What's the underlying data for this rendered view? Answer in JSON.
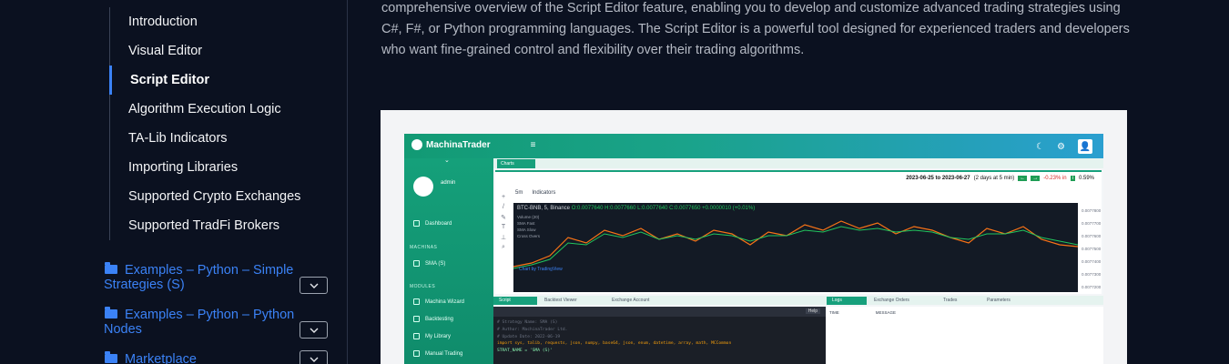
{
  "sidebar": {
    "subnav_items": [
      {
        "label": "Introduction",
        "active": false
      },
      {
        "label": "Visual Editor",
        "active": false
      },
      {
        "label": "Script Editor",
        "active": true
      },
      {
        "label": "Algorithm Execution Logic",
        "active": false
      },
      {
        "label": "TA-Lib Indicators",
        "active": false
      },
      {
        "label": "Importing Libraries",
        "active": false
      },
      {
        "label": "Supported Crypto Exchanges",
        "active": false
      },
      {
        "label": "Supported TradFi Brokers",
        "active": false
      }
    ],
    "sections": [
      {
        "label": "Examples – Python – Simple Strategies (S)"
      },
      {
        "label": "Examples – Python – Python Nodes"
      },
      {
        "label": "Marketplace"
      }
    ],
    "icons": {
      "section": "folder-icon",
      "toggle": "chevron-down-icon"
    }
  },
  "main": {
    "description": "comprehensive overview of the Script Editor feature, enabling you to develop and customize advanced trading strategies using C#, F#, or Python programming languages. The Script Editor is a powerful tool designed for experienced traders and developers who want fine-grained control and flexibility over their trading algorithms."
  },
  "screenshot": {
    "brand": "MachinaTrader",
    "user": "admin",
    "tab": "Charts",
    "nav_headers": [
      "MACHINAS",
      "MODULES"
    ],
    "nav_items": [
      "Dashboard",
      "SMA (S)",
      "Machina Wizard",
      "Backtesting",
      "My Library",
      "Manual Trading"
    ],
    "date_range": "2023-06-25 to 2023-06-27",
    "date_span": "(2 days at 5 min)",
    "change_neg": "-0.23% in",
    "change_pos": "0.59%",
    "toolbar": [
      "5m",
      "Indicators"
    ],
    "symbol": "BTC-BNB, 5, Binance",
    "ohlc": "O:0.0077640  H:0.0077660  L:0.0077640  C:0.0077650  +0.0000010 (+0.01%)",
    "series_labels": [
      "Volume (20)",
      "SMA Fast",
      "SMA Slow",
      "Cross Overs"
    ],
    "price_ticks": [
      "0.0077800",
      "0.0077700",
      "0.0077600",
      "0.0077500",
      "0.0077400",
      "0.0077300",
      "0.0077200"
    ],
    "watermark": "Chart by TradingView",
    "lower_tabs": [
      "Script",
      "Backtest Viewer",
      "Exchange Account",
      "Logs",
      "Exchange Orders",
      "Trades",
      "Parameters"
    ],
    "help": "Help",
    "log_headers": [
      "TIME",
      "MESSAGE"
    ],
    "code_lines": [
      "# Strategy Name: SMA (S)",
      "# Author: MachinaTrader Ltd.",
      "# Update Date: 2022-06-19",
      "import sys, talib, requests, json, numpy, base64, json, enum, datetime, array, math, MCCommon",
      "STRAT_NAME = 'SMA (S)'"
    ]
  },
  "colors": {
    "background": "#0b1120",
    "accent": "#3b82f6",
    "app_green": "#17a07c",
    "chart_bg": "#131a25"
  }
}
